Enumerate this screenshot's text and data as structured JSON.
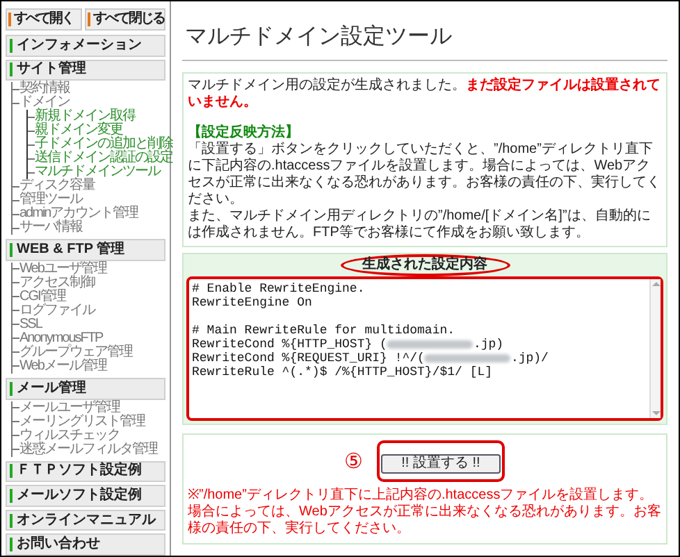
{
  "sidebar": {
    "top_buttons": [
      "すべて開く",
      "すべて閉じる"
    ],
    "sections": [
      {
        "title": "インフォメーション"
      },
      {
        "title": "サイト管理",
        "items": [
          {
            "label": "契約情報"
          },
          {
            "label": "ドメイン",
            "children": [
              {
                "label": "新規ドメイン取得"
              },
              {
                "label": "親ドメイン変更"
              },
              {
                "label": "子ドメインの追加と削除"
              },
              {
                "label": "送信ドメイン認証の設定"
              },
              {
                "label": "マルチドメインツール"
              }
            ]
          },
          {
            "label": "ディスク容量"
          },
          {
            "label": "管理ツール"
          },
          {
            "label": "adminアカウント管理"
          },
          {
            "label": "サーバ情報"
          }
        ]
      },
      {
        "title": "WEB & FTP 管理",
        "items": [
          {
            "label": "Webユーザ管理"
          },
          {
            "label": "アクセス制御"
          },
          {
            "label": "CGI管理"
          },
          {
            "label": "ログファイル"
          },
          {
            "label": "SSL"
          },
          {
            "label": "AnonymousFTP"
          },
          {
            "label": "グループウェア管理"
          },
          {
            "label": "Webメール管理"
          }
        ]
      },
      {
        "title": "メール管理",
        "items": [
          {
            "label": "メールユーザ管理"
          },
          {
            "label": "メーリングリスト管理"
          },
          {
            "label": "ウィルスチェック"
          },
          {
            "label": "迷惑メールフィルタ管理"
          }
        ]
      },
      {
        "title": "ＦＴＰソフト設定例"
      },
      {
        "title": "メールソフト設定例"
      },
      {
        "title": "オンラインマニュアル"
      },
      {
        "title": "お問い合わせ"
      }
    ]
  },
  "main": {
    "title": "マルチドメイン設定ツール",
    "notice": "マルチドメイン用の設定が生成されました。**まだ設定ファイルは設置されていません。**",
    "method_heading": "【設定反映方法】",
    "paragraphs": [
      "「設置する」ボタンをクリックしていただくと、”/home”ディレクトリ直下に下記内容の.htaccessファイルを設置します。場合によっては、Webアクセスが正常に出来なくなる恐れがあります。お客様の責任の下、実行してください。",
      "また、マルチドメイン用ディレクトリの”/home/[ドメイン名]”は、自動的には作成されません。FTP等でお客様にて作成をお願い致します。"
    ],
    "generated_heading": "生成された設定内容",
    "lines": [
      {
        "kind": "code",
        "parts": [
          {
            "kind": "text",
            "text": "# Enable RewriteEngine."
          }
        ]
      },
      {
        "kind": "code",
        "parts": [
          {
            "kind": "text",
            "text": "RewriteEngine On"
          }
        ]
      },
      {
        "kind": "blank"
      },
      {
        "kind": "code",
        "parts": [
          {
            "kind": "text",
            "text": "# Main RewriteRule for multidomain."
          }
        ]
      },
      {
        "kind": "code",
        "parts": [
          {
            "kind": "text",
            "text": "RewriteCond %{HTTP_HOST} ("
          },
          {
            "kind": "redacted"
          },
          {
            "kind": "text",
            "text": ".jp)"
          }
        ]
      },
      {
        "kind": "code",
        "parts": [
          {
            "kind": "text",
            "text": "RewriteCond %{REQUEST_URI} !^/("
          },
          {
            "kind": "redacted"
          },
          {
            "kind": "text",
            "text": ".jp)/"
          }
        ]
      },
      {
        "kind": "code",
        "parts": [
          {
            "kind": "text",
            "text": "RewriteRule ^(.*)$ /%{HTTP_HOST}/$1/ [L]"
          }
        ]
      }
    ],
    "step_mark": "⑤",
    "button": "!! 設置する !!",
    "note": "※”/home”ディレクトリ直下に上記内容の.htaccessファイルを設置します。場合によっては、Webアクセスが正常に出来なくなる恐れがあります。お客様の責任の下、実行してください。"
  }
}
